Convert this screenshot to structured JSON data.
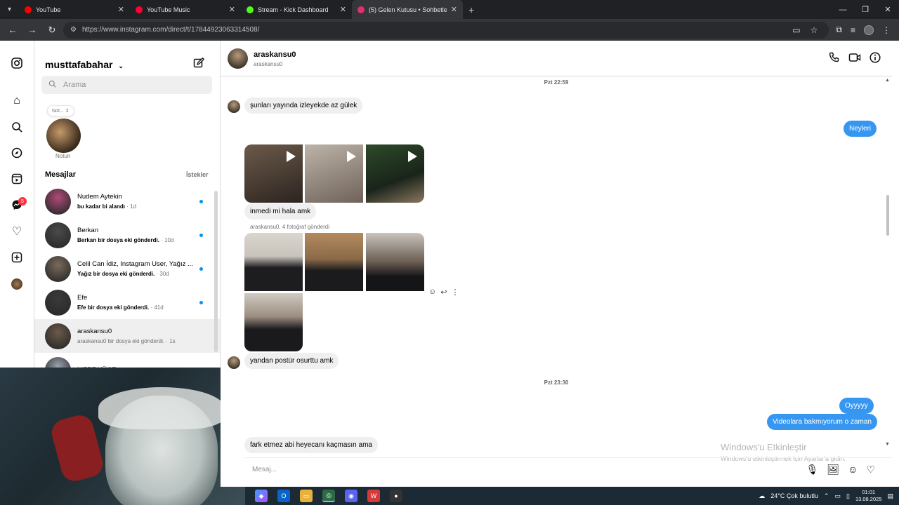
{
  "browser": {
    "tabs": [
      {
        "title": "YouTube",
        "color": "#ff0000",
        "active": false
      },
      {
        "title": "YouTube Music",
        "color": "#ff0033",
        "active": false
      },
      {
        "title": "Stream - Kick Dashboard",
        "color": "#53fc18",
        "active": false
      },
      {
        "title": "(5) Gelen Kutusu • Sohbetler",
        "color": "#e1306c",
        "active": true
      }
    ],
    "url": "https://www.instagram.com/direct/t/17844923063314508/"
  },
  "rail": {
    "badge_count": "5"
  },
  "inbox": {
    "username": "musttafabahar",
    "search_placeholder": "Arama",
    "note_bubble": "Not...",
    "note_label": "Notun",
    "messages_label": "Mesajlar",
    "requests_label": "İstekler",
    "conversations": [
      {
        "name": "Nudem Aytekin",
        "preview": "bu kadar bi alandı",
        "time": " · 1d",
        "unread": true,
        "color": "#b04a7a"
      },
      {
        "name": "Berkan",
        "preview": "Berkan bir dosya eki gönderdi.",
        "time": " · 10d",
        "unread": true,
        "color": "#4a4a4a"
      },
      {
        "name": "Celil Can İdiz, Instagram User, Yağız ...",
        "preview": "Yağız bir dosya eki gönderdi.",
        "time": " · 30d",
        "unread": true,
        "color": "#7a6a5a"
      },
      {
        "name": "Efe",
        "preview": "Efe bir dosya eki gönderdi.",
        "time": " · 41d",
        "unread": true,
        "color": "#3a3a3a"
      },
      {
        "name": "araskansu0",
        "preview": "araskansu0 bir dosya eki gönderdi.",
        "time": " · 1s",
        "unread": false,
        "color": "#6b5a48"
      },
      {
        "name": "MERT YÜCE",
        "preview": "",
        "time": "",
        "unread": false,
        "color": "#9aa2ad"
      }
    ]
  },
  "chat": {
    "name": "araskansu0",
    "username": "araskansu0",
    "timestamp1": "Pzt 22:59",
    "timestamp2": "Pzt 23:30",
    "msg_in_1": "şunları yayında izleyekde az gülek",
    "msg_out_1": "Neyleri",
    "msg_in_2": "inmedi mi hala amk",
    "photos_note": "araskansu0, 4 fotoğraf gönderdi",
    "msg_in_3": "yandan postür osurttu amk",
    "msg_out_2": "Oyyyyy",
    "msg_out_3": "Videolara bakmıyorum o zaman",
    "msg_in_4": "fark etmez abi heyecanı kaçmasın ama",
    "composer_placeholder": "Mesaj..."
  },
  "watermark": {
    "line1": "Windows'u Etkinleştir",
    "line2": "Windows'u etkinleştirmek için Ayarlar'a gidin."
  },
  "taskbar": {
    "weather": "24°C  Çok bulutlu",
    "time": "01:01",
    "date": "13.08.2025"
  }
}
